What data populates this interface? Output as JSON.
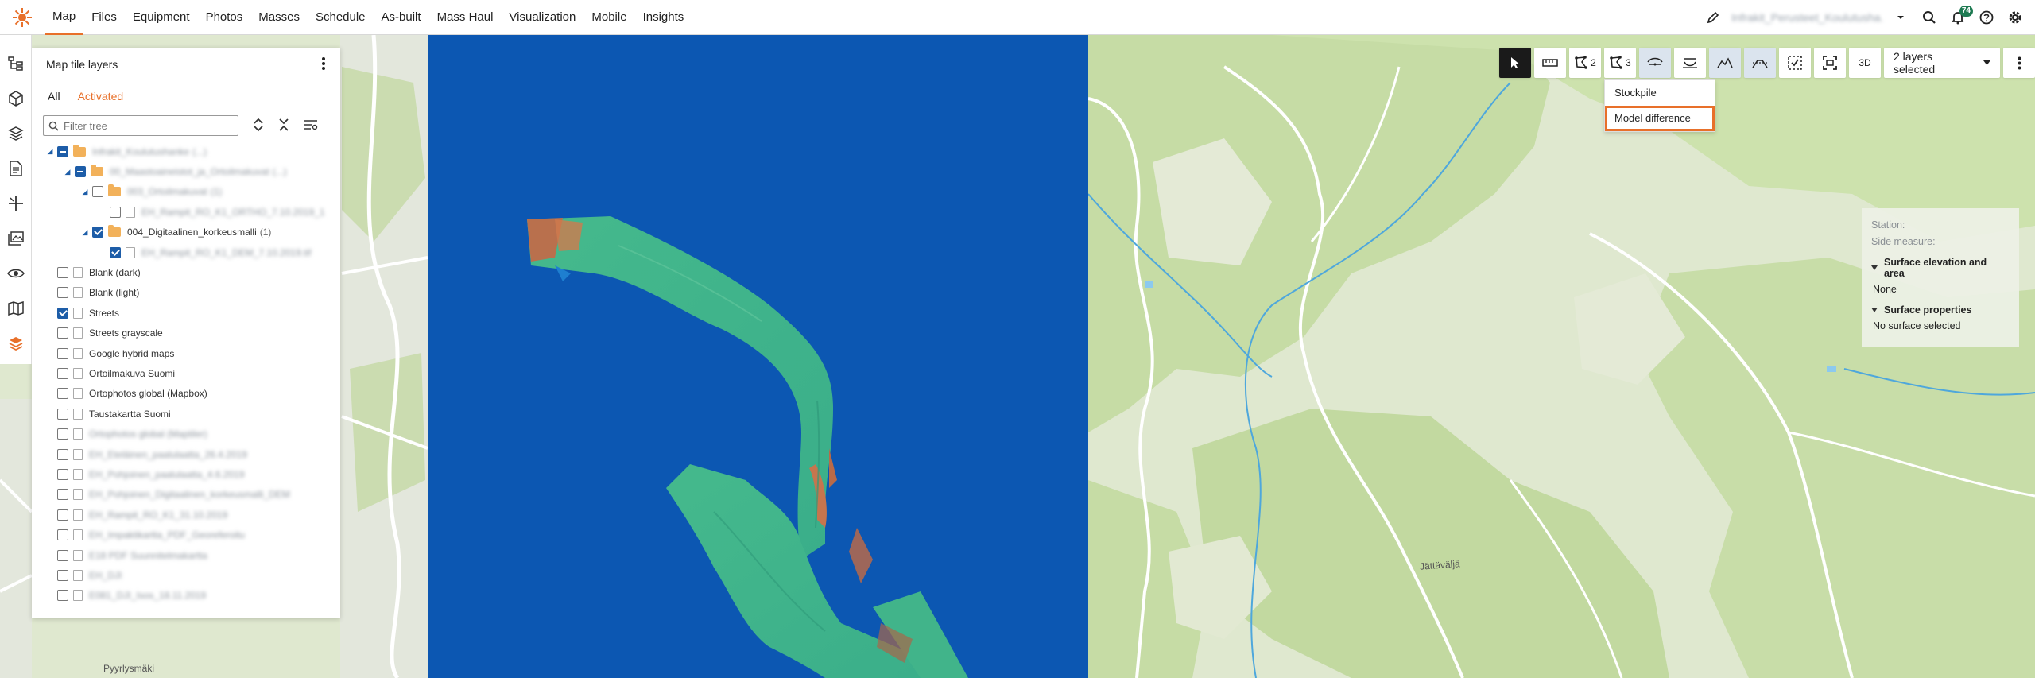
{
  "nav": {
    "items": [
      "Map",
      "Files",
      "Equipment",
      "Photos",
      "Masses",
      "Schedule",
      "As-built",
      "Mass Haul",
      "Visualization",
      "Mobile",
      "Insights"
    ],
    "active": "Map",
    "project_name": "Infrakit_Perusteet_Koulutusha...",
    "notification_count": "74",
    "accent": "#e8702a"
  },
  "rail": {
    "icons": [
      "hierarchy-icon",
      "cube-icon",
      "layers-stack-icon",
      "document-icon",
      "crosshair-icon",
      "gallery-icon",
      "eye-scan-icon",
      "map-icon",
      "tile-layers-icon"
    ]
  },
  "panel": {
    "title": "Map tile layers",
    "tabs": [
      "All",
      "Activated"
    ],
    "filter_placeholder": "Filter tree",
    "tree": [
      {
        "label": "Infrakit_Koulutushanke",
        "count": "(...)",
        "level": 0,
        "type": "folder",
        "state": "ind",
        "caret": true,
        "blurred": true
      },
      {
        "label": "00_Maastoaineistot_ja_Ortoilmakuvat",
        "count": "(...)",
        "level": 1,
        "type": "folder",
        "state": "ind",
        "caret": true,
        "blurred": true
      },
      {
        "label": "003_Ortoilmakuvat",
        "count": "(1)",
        "level": 2,
        "type": "folder",
        "state": "off",
        "caret": true,
        "blurred": true
      },
      {
        "label": "EH_Rampit_RO_K1_ORTHO_7.10.2019_1",
        "count": "",
        "level": 3,
        "type": "file",
        "state": "off",
        "caret": false,
        "blurred": true
      },
      {
        "label": "004_Digitaalinen_korkeusmalli",
        "count": "(1)",
        "level": 2,
        "type": "folder",
        "state": "on",
        "caret": true,
        "blurred": false
      },
      {
        "label": "EH_Rampit_RO_K1_DEM_7.10.2019.tif",
        "count": "",
        "level": 3,
        "type": "file",
        "state": "on",
        "caret": false,
        "blurred": true
      },
      {
        "label": "Blank (dark)",
        "count": "",
        "level": 0,
        "type": "file",
        "state": "off",
        "caret": false,
        "blurred": false
      },
      {
        "label": "Blank (light)",
        "count": "",
        "level": 0,
        "type": "file",
        "state": "off",
        "caret": false,
        "blurred": false
      },
      {
        "label": "Streets",
        "count": "",
        "level": 0,
        "type": "file",
        "state": "on",
        "caret": false,
        "blurred": false
      },
      {
        "label": "Streets grayscale",
        "count": "",
        "level": 0,
        "type": "file",
        "state": "off",
        "caret": false,
        "blurred": false
      },
      {
        "label": "Google hybrid maps",
        "count": "",
        "level": 0,
        "type": "file",
        "state": "off",
        "caret": false,
        "blurred": false
      },
      {
        "label": "Ortoilmakuva Suomi",
        "count": "",
        "level": 0,
        "type": "file",
        "state": "off",
        "caret": false,
        "blurred": false
      },
      {
        "label": "Ortophotos global (Mapbox)",
        "count": "",
        "level": 0,
        "type": "file",
        "state": "off",
        "caret": false,
        "blurred": false
      },
      {
        "label": "Taustakartta Suomi",
        "count": "",
        "level": 0,
        "type": "file",
        "state": "off",
        "caret": false,
        "blurred": false
      },
      {
        "label": "Ortophotos global (Maptiler)",
        "count": "",
        "level": 0,
        "type": "file",
        "state": "off",
        "caret": false,
        "blurred": true
      },
      {
        "label": "EH_Eteläinen_paalulaatta_26.4.2019",
        "count": "",
        "level": 0,
        "type": "file",
        "state": "off",
        "caret": false,
        "blurred": true
      },
      {
        "label": "EH_Pohjoinen_paalulaatta_4.6.2019",
        "count": "",
        "level": 0,
        "type": "file",
        "state": "off",
        "caret": false,
        "blurred": true
      },
      {
        "label": "EH_Pohjoinen_Digitaalinen_korkeusmalli_DEM",
        "count": "",
        "level": 0,
        "type": "file",
        "state": "off",
        "caret": false,
        "blurred": true
      },
      {
        "label": "EH_Rampit_RO_K1_31.10.2019",
        "count": "",
        "level": 0,
        "type": "file",
        "state": "off",
        "caret": false,
        "blurred": true
      },
      {
        "label": "EH_Impaktikartta_PDF_Georeferoitu",
        "count": "",
        "level": 0,
        "type": "file",
        "state": "off",
        "caret": false,
        "blurred": true
      },
      {
        "label": "E18 PDF Suunnitelmakartta",
        "count": "",
        "level": 0,
        "type": "file",
        "state": "off",
        "caret": false,
        "blurred": true
      },
      {
        "label": "EH_DJI",
        "count": "",
        "level": 0,
        "type": "file",
        "state": "off",
        "caret": false,
        "blurred": true
      },
      {
        "label": "E081_DJI_Isos_18.11.2019",
        "count": "",
        "level": 0,
        "type": "file",
        "state": "off",
        "caret": false,
        "blurred": true
      }
    ]
  },
  "toolbar": {
    "buttons": [
      {
        "name": "select-tool-button",
        "icon": "cursor-icon",
        "label": "",
        "state": "dark"
      },
      {
        "name": "measure-tool-button",
        "icon": "ruler-icon",
        "label": "",
        "state": ""
      },
      {
        "name": "polygon-tool-2-button",
        "icon": "polygon-icon",
        "label": "2",
        "state": ""
      },
      {
        "name": "polygon-tool-3-button",
        "icon": "polygon-icon",
        "label": "3",
        "state": ""
      },
      {
        "name": "volume-tool-button",
        "icon": "volume-icon",
        "label": "",
        "state": "sel"
      },
      {
        "name": "cut-fill-tool-button",
        "icon": "cutfill-icon",
        "label": "",
        "state": ""
      },
      {
        "name": "profile-tool-button",
        "icon": "profile-icon",
        "label": "",
        "state": "sel"
      },
      {
        "name": "cross-section-tool-button",
        "icon": "cross-section-icon",
        "label": "",
        "state": "sel"
      },
      {
        "name": "checklist-tool-button",
        "icon": "checklist-icon",
        "label": "",
        "state": ""
      },
      {
        "name": "fit-view-button",
        "icon": "fit-icon",
        "label": "",
        "state": ""
      },
      {
        "name": "3d-toggle-button",
        "icon": "",
        "label": "3D",
        "state": ""
      },
      {
        "name": "layers-selected-button",
        "icon": "chevron-down-icon",
        "label": "2 layers selected",
        "state": ""
      },
      {
        "name": "more-options-button",
        "icon": "kebab-icon",
        "label": "",
        "state": ""
      }
    ],
    "dropdown": [
      "Stockpile",
      "Model difference"
    ],
    "dropdown_highlighted": "Model difference"
  },
  "info": {
    "station": "Station:",
    "side_measure": "Side measure:",
    "elev_title": "Surface elevation and area",
    "elev_value": "None",
    "props_title": "Surface properties",
    "props_value": "No surface selected"
  },
  "map_labels": [
    "Jättäväljä",
    "Pyyrlysmäki"
  ],
  "colors": {
    "dem_background": "#0c57b2",
    "dem_surface": "#3fb58a",
    "map_green": "#c6dca5",
    "water": "#4ea7dc"
  }
}
